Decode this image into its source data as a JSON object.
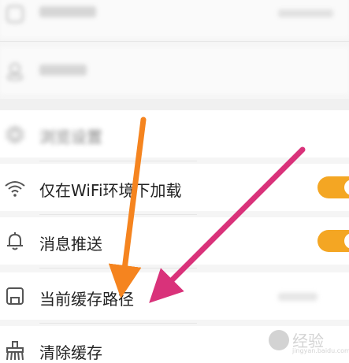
{
  "rows": [
    {
      "label": "浏览设置",
      "icon": "gear-icon"
    },
    {
      "label": "仅在WiFi环境下加载",
      "icon": "wifi-icon"
    },
    {
      "label": "消息推送",
      "icon": "bell-icon"
    },
    {
      "label": "当前缓存路径",
      "icon": "save-icon"
    },
    {
      "label": "清除缓存",
      "icon": "broom-icon"
    }
  ],
  "watermark": {
    "text": "经验",
    "url": "jingyan.baidu.com"
  },
  "colors": {
    "toggle_on": "#f4a623",
    "arrow_orange": "#f5841f",
    "arrow_pink": "#d9327a"
  }
}
